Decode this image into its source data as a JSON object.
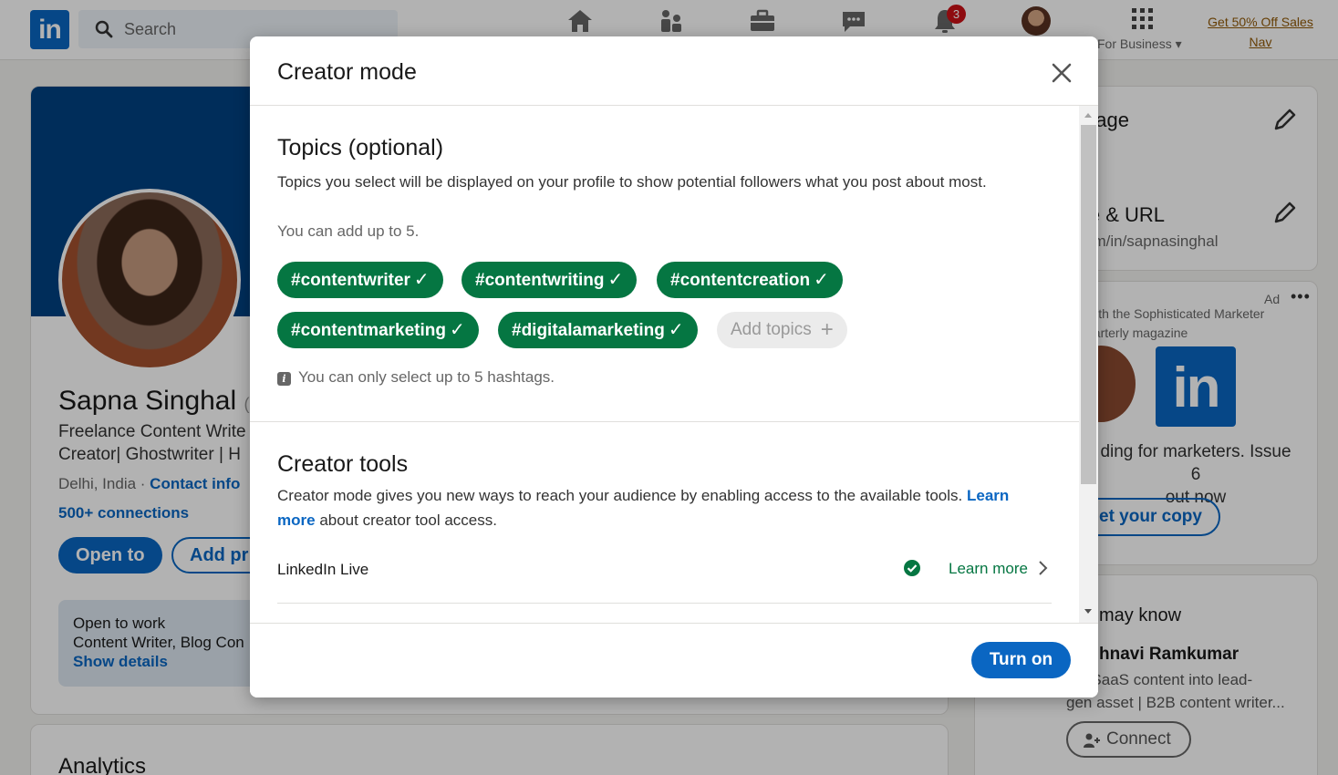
{
  "nav": {
    "search_placeholder": "Search",
    "notification_count": "3",
    "for_business": "For Business",
    "premium_line1": "Get 50% Off Sales",
    "premium_line2": "Nav"
  },
  "profile": {
    "name": "Sapna Singhal",
    "name_suffix": "(S",
    "headline_line1": "Freelance Content Write",
    "headline_line2": "Creator| Ghostwriter | H",
    "location": "Delhi, India · ",
    "contact_info": "Contact info",
    "connections": "500+ connections",
    "open_to_button": "Open to",
    "add_profile_button": "Add pr",
    "open_to_work": {
      "title": "Open to work",
      "roles": "Content Writer, Blog Con",
      "show_details": "Show details"
    }
  },
  "analytics": {
    "title": "Analytics"
  },
  "sidebar": {
    "language_title": "uage",
    "profile_url_title": "le & URL",
    "profile_url_value": "om/in/sapnasinghal",
    "ad": {
      "label": "Ad",
      "dots": "•••",
      "text_line1": "with the Sophisticated Marketer",
      "text_line2": "uarterly magazine",
      "desc_line1": "ding for marketers. Issue 6",
      "desc_line2": "out now",
      "cta": "et your copy"
    },
    "pymk": {
      "title": "may know",
      "name": "hnavi Ramkumar",
      "desc_line1": "ing SaaS content into lead-",
      "desc_line2": "gen asset | B2B content writer...",
      "connect": "Connect"
    }
  },
  "modal": {
    "title": "Creator mode",
    "topics": {
      "title": "Topics (optional)",
      "description": "Topics you select will be displayed on your profile to show potential followers what you post about most.",
      "limit_note": "You can add up to 5.",
      "selected": [
        "#contentwriter",
        "#contentwriting",
        "#contentcreation",
        "#contentmarketing",
        "#digitalamarketing"
      ],
      "add_label": "Add topics",
      "max_note": "You can only select up to 5 hashtags."
    },
    "tools": {
      "title": "Creator tools",
      "description": "Creator mode gives you new ways to reach your audience by enabling access to the available tools.",
      "learn_more_link": "Learn more",
      "description_tail": "about creator tool access.",
      "items": [
        {
          "name": "LinkedIn Live",
          "learn_more": "Learn more"
        }
      ]
    },
    "turn_on_button": "Turn on"
  },
  "colors": {
    "brand_blue": "#0a66c2",
    "topic_green": "#057642",
    "overlay": "rgba(0,0,0,0.3)"
  }
}
